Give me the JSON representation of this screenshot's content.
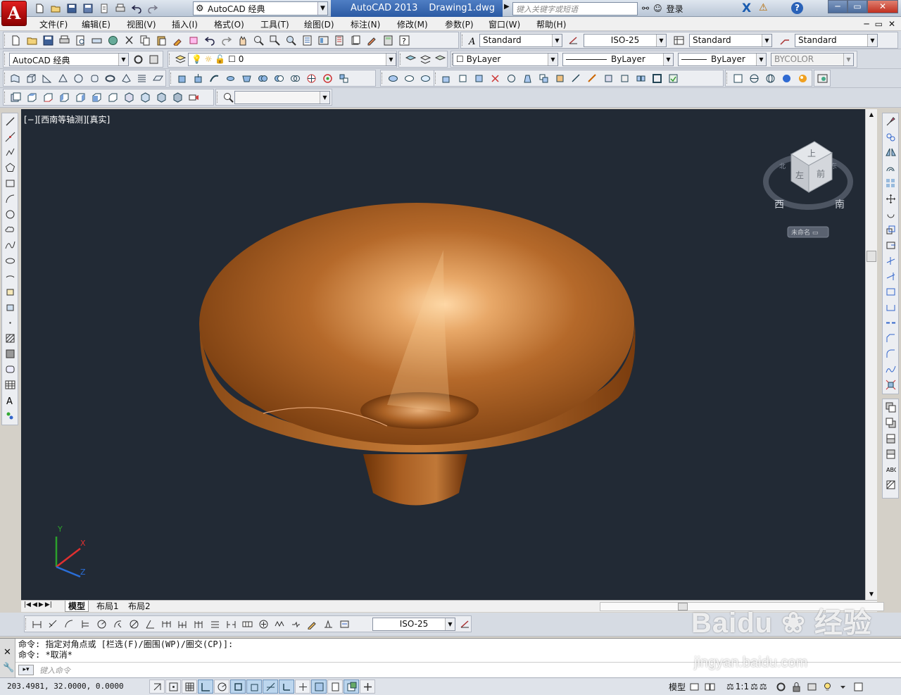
{
  "titlebar": {
    "logo": "A",
    "workspace": "AutoCAD 经典",
    "app_name": "AutoCAD 2013",
    "file_name": "Drawing1.dwg",
    "search_placeholder": "键入关键字或短语",
    "login": "登录",
    "window_buttons": [
      "─",
      "▭",
      "✕"
    ]
  },
  "menu": {
    "items": [
      "文件(F)",
      "编辑(E)",
      "视图(V)",
      "插入(I)",
      "格式(O)",
      "工具(T)",
      "绘图(D)",
      "标注(N)",
      "修改(M)",
      "参数(P)",
      "窗口(W)",
      "帮助(H)"
    ],
    "mdi": [
      "─",
      "▭",
      "✕"
    ]
  },
  "toolbar": {
    "text_style": "Standard",
    "dim_style": "ISO-25",
    "table_style": "Standard",
    "mleader_style": "Standard",
    "workspace2": "AutoCAD 经典",
    "layer": "0",
    "color": "ByLayer",
    "linetype": "ByLayer",
    "lineweight": "ByLayer",
    "plotstyle": "BYCOLOR",
    "dim_style_bottom": "ISO-25"
  },
  "viewport": {
    "label": "[−][西南等轴测][真实]",
    "viewcube": {
      "top": "上",
      "front": "前",
      "left": "左",
      "south": "南",
      "west": "西",
      "north": "北",
      "east": "东",
      "wcs": "未命名 ▭"
    },
    "ucs": {
      "x": "X",
      "y": "Y",
      "z": "Z"
    },
    "object_color": "#b5692a"
  },
  "tabs": {
    "model": "模型",
    "layout1": "布局1",
    "layout2": "布局2"
  },
  "command": {
    "line1": "命令: 指定对角点或 [栏选(F)/圈围(WP)/圈交(CP)]:",
    "line2": "命令: *取消*",
    "prompt": "键入命令"
  },
  "status": {
    "coords": "203.4981, 32.0000, 0.0000",
    "model": "模型",
    "scale": "1:1"
  },
  "watermark": {
    "brand": "Baidu",
    "brand_cn": "经验",
    "url": "jingyan.baidu.com"
  }
}
